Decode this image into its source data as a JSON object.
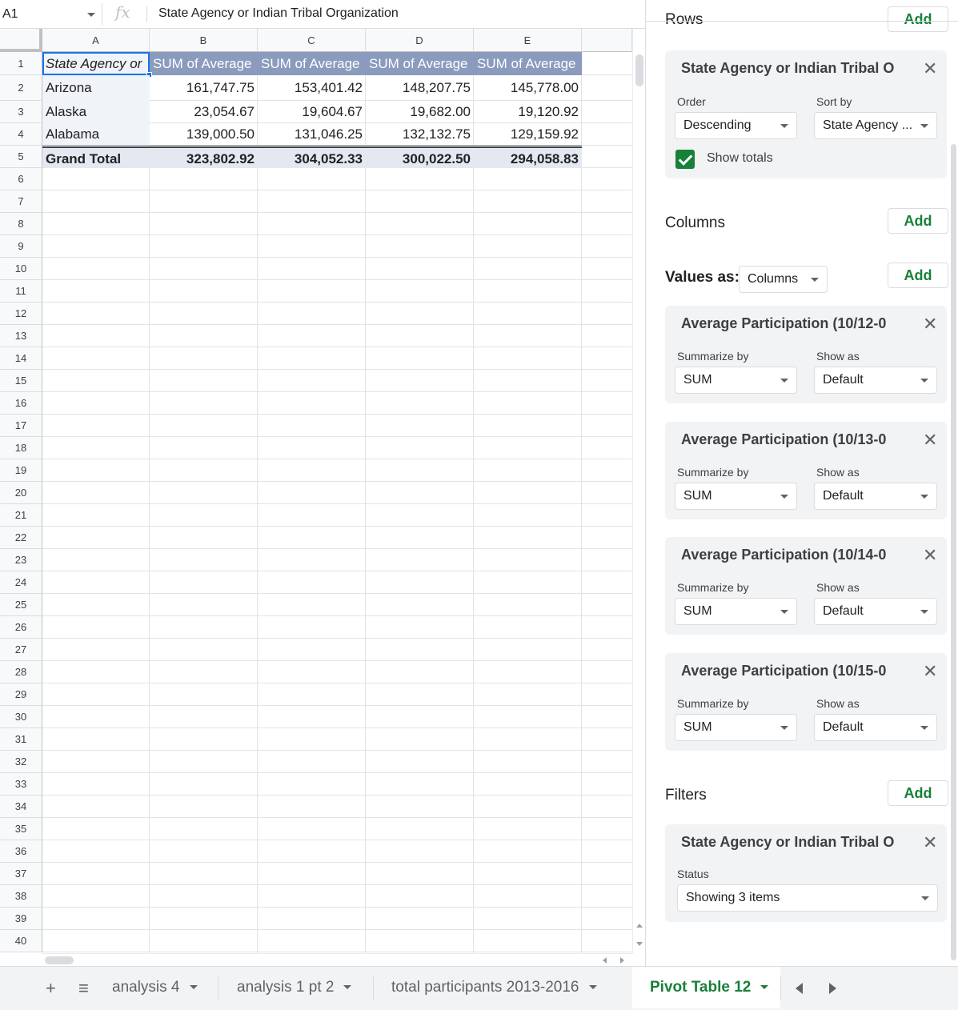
{
  "formula_bar": {
    "name_box": "A1",
    "fx_symbol": "fx",
    "content": "State Agency or Indian Tribal Organization"
  },
  "sheet": {
    "column_headers": [
      "A",
      "B",
      "C",
      "D",
      "E"
    ],
    "row_numbers": [
      "1",
      "2",
      "3",
      "4",
      "5",
      "6",
      "7",
      "8",
      "9",
      "10",
      "11",
      "12",
      "13",
      "14",
      "15",
      "16",
      "17",
      "18",
      "19",
      "20",
      "21",
      "22",
      "23",
      "24",
      "25",
      "26",
      "27",
      "28",
      "29",
      "30",
      "31",
      "32",
      "33",
      "34",
      "35",
      "36",
      "37",
      "38",
      "39",
      "40"
    ],
    "pivot": {
      "header": [
        "State Agency or",
        "SUM of Average",
        "SUM of Average",
        "SUM of Average",
        "SUM of Average"
      ],
      "rows": [
        [
          "Arizona",
          "161,747.75",
          "153,401.42",
          "148,207.75",
          "145,778.00"
        ],
        [
          "Alaska",
          "23,054.67",
          "19,604.67",
          "19,682.00",
          "19,120.92"
        ],
        [
          "Alabama",
          "139,000.50",
          "131,046.25",
          "132,132.75",
          "129,159.92"
        ]
      ],
      "total": [
        "Grand Total",
        "323,802.92",
        "304,052.33",
        "300,022.50",
        "294,058.83"
      ]
    }
  },
  "tabs": {
    "items": [
      {
        "label": "analysis 4",
        "active": false
      },
      {
        "label": "analysis 1 pt 2",
        "active": false
      },
      {
        "label": "total participants 2013-2016",
        "active": false
      },
      {
        "label": "Pivot Table 12",
        "active": true
      }
    ]
  },
  "pivot_editor": {
    "rows_section": "Rows",
    "add_label": "Add",
    "row_card": {
      "title": "State Agency or Indian Tribal O",
      "order_label": "Order",
      "order_value": "Descending",
      "sortby_label": "Sort by",
      "sortby_value": "State Agency ...",
      "show_totals_label": "Show totals"
    },
    "columns_section": "Columns",
    "values_as_label": "Values as:",
    "values_as_value": "Columns",
    "value_cards": [
      {
        "title": "Average Participation (10/12-0",
        "summarize_label": "Summarize by",
        "summarize_value": "SUM",
        "showas_label": "Show as",
        "showas_value": "Default"
      },
      {
        "title": "Average Participation (10/13-0",
        "summarize_label": "Summarize by",
        "summarize_value": "SUM",
        "showas_label": "Show as",
        "showas_value": "Default"
      },
      {
        "title": "Average Participation (10/14-0",
        "summarize_label": "Summarize by",
        "summarize_value": "SUM",
        "showas_label": "Show as",
        "showas_value": "Default"
      },
      {
        "title": "Average Participation (10/15-0",
        "summarize_label": "Summarize by",
        "summarize_value": "SUM",
        "showas_label": "Show as",
        "showas_value": "Default"
      }
    ],
    "filters_section": "Filters",
    "filter_card": {
      "title": "State Agency or Indian Tribal O",
      "status_label": "Status",
      "status_value": "Showing 3 items"
    }
  },
  "colors": {
    "accent_green": "#188038",
    "pivot_header_bg": "#8a9bbd",
    "pivot_total_bg": "#e3e8f1",
    "panel_card_bg": "#f1f3f4"
  },
  "icons": [
    "fx-icon",
    "add-sheet-icon",
    "all-sheets-icon",
    "close-icon",
    "dropdown-caret-icon",
    "checkbox-checked-icon",
    "tab-prev-icon",
    "tab-next-icon"
  ]
}
